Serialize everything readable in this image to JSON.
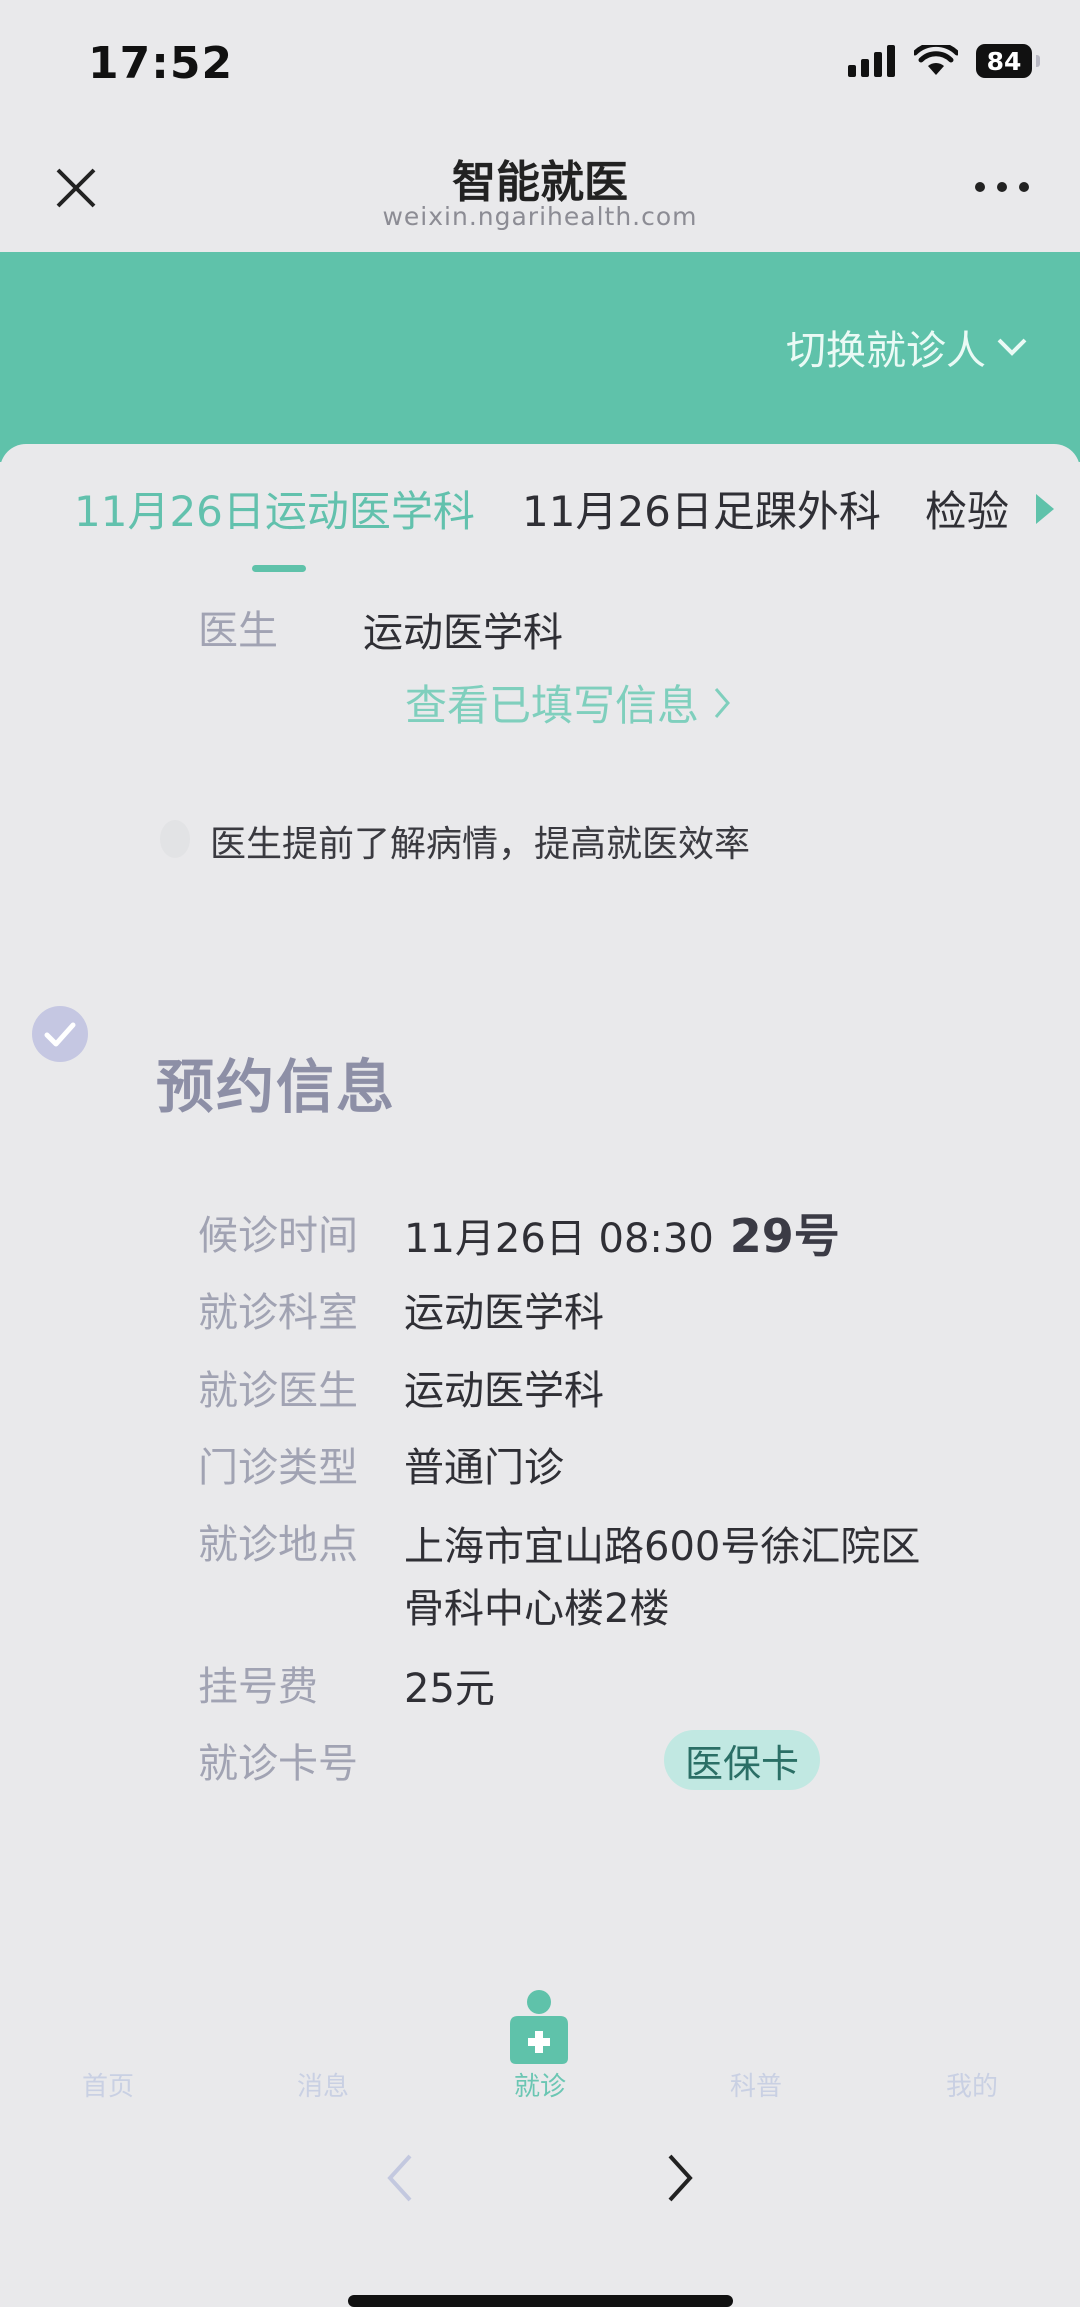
{
  "status_bar": {
    "time": "17:52",
    "battery": "84"
  },
  "nav": {
    "title": "智能就医",
    "subtitle": "weixin.ngarihealth.com"
  },
  "header": {
    "switch_patient": "切换就诊人"
  },
  "tabs": [
    {
      "label": "11月26日运动医学科",
      "active": true
    },
    {
      "label": "11月26日足踝外科",
      "active": false
    },
    {
      "label": "检验",
      "active": false
    }
  ],
  "doctor_row": {
    "label": "医生",
    "value": "运动医学科"
  },
  "view_filled_link": "查看已填写信息",
  "tip_text": "医生提前了解病情，提高就医效率",
  "appointment": {
    "section_title": "预约信息",
    "wait_time": {
      "label": "候诊时间",
      "value": "11月26日 08:30",
      "number": "29号"
    },
    "department": {
      "label": "就诊科室",
      "value": "运动医学科"
    },
    "doctor": {
      "label": "就诊医生",
      "value": "运动医学科"
    },
    "clinic_type": {
      "label": "门诊类型",
      "value": "普通门诊"
    },
    "location": {
      "label": "就诊地点",
      "value_line1": "上海市宜山路600号徐汇院区",
      "value_line2": "骨科中心楼2楼"
    },
    "fee": {
      "label": "挂号费",
      "value": "25元"
    },
    "card_no": {
      "label": "就诊卡号",
      "badge": "医保卡"
    }
  },
  "bottom_tabs": [
    "首页",
    "消息",
    "就诊",
    "科普",
    "我的"
  ],
  "active_bottom_tab": "就诊",
  "colors": {
    "accent": "#5fc2aa",
    "label": "#a1a3b3",
    "section_title": "#8d8fa6"
  }
}
